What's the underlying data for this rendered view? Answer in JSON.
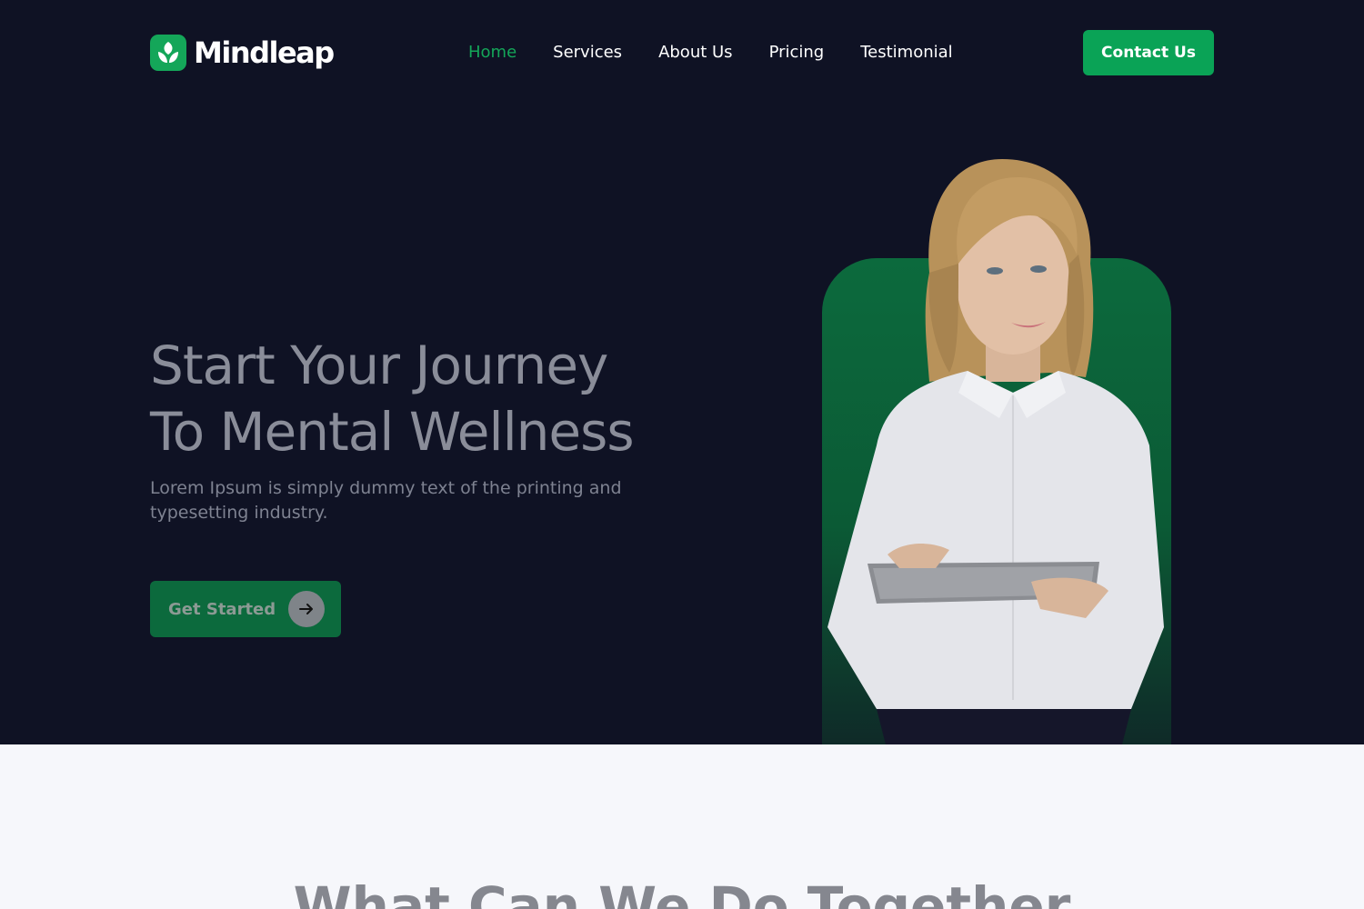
{
  "header": {
    "logo_text": "Mindleap",
    "nav": [
      {
        "label": "Home",
        "active": true
      },
      {
        "label": "Services",
        "active": false
      },
      {
        "label": "About Us",
        "active": false
      },
      {
        "label": "Pricing",
        "active": false
      },
      {
        "label": "Testimonial",
        "active": false
      }
    ],
    "contact_label": "Contact Us"
  },
  "hero": {
    "headline_line1": "Start Your Journey",
    "headline_line2": "To Mental Wellness",
    "subtext": "Lorem Ipsum is simply dummy text of the printing and typesetting industry.",
    "cta_label": "Get Started",
    "cta_icon": "arrow-right-icon"
  },
  "services": {
    "title": "What Can We Do Together"
  },
  "colors": {
    "accent": "#14a659",
    "background_dark": "#0f1224",
    "background_light": "#f6f7fb"
  }
}
